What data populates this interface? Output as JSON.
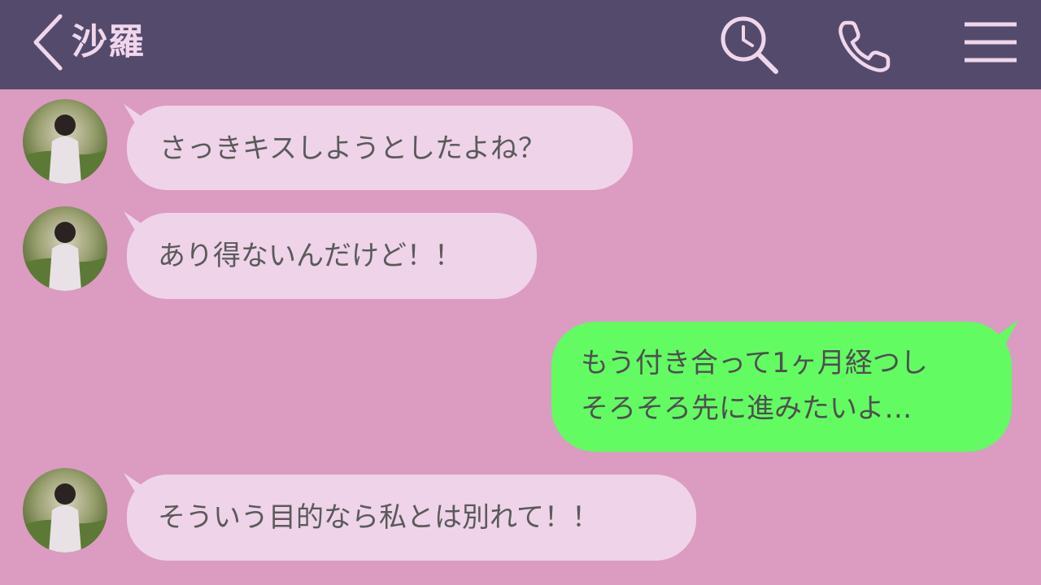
{
  "header": {
    "title": "沙羅",
    "icons": {
      "back": "chevron-left-icon",
      "search": "search-clock-icon",
      "call": "phone-icon",
      "menu": "hamburger-menu-icon"
    },
    "colors": {
      "background": "#544b6c",
      "foreground": "#f0d6ec"
    }
  },
  "chat": {
    "background": "#dc9bc1",
    "messages": [
      {
        "sender": "沙羅",
        "side": "left",
        "text": "さっきキスしようとしたよね？"
      },
      {
        "sender": "沙羅",
        "side": "left",
        "text": "あり得ないんだけど！！"
      },
      {
        "sender": "me",
        "side": "right",
        "lines": [
          "もう付き合って1ヶ月経つし",
          "そろそろ先に進みたいよ…"
        ]
      },
      {
        "sender": "沙羅",
        "side": "left",
        "text": "そういう目的なら私とは別れて！！"
      }
    ],
    "colors": {
      "left_bubble": "#efd3e9",
      "right_bubble": "#62fb62"
    }
  }
}
